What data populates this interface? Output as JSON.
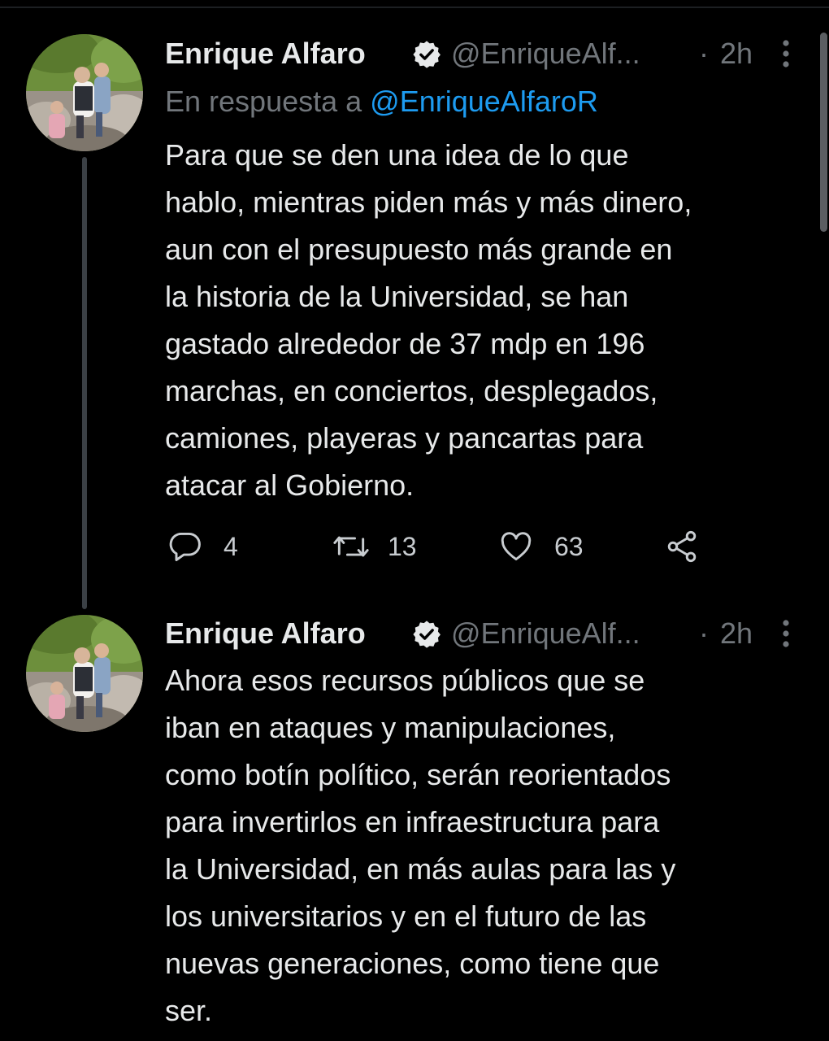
{
  "tweets": [
    {
      "author_name": "Enrique Alfaro",
      "verified": true,
      "handle": "@EnriqueAlf...",
      "separator": "·",
      "time": "2h",
      "reply_prefix": "En respuesta a",
      "reply_to": "@EnriqueAlfaroR",
      "text_lines": [
        "Para que se den una idea de lo que",
        "hablo, mientras piden más y más dinero,",
        "aun con el presupuesto más grande en",
        "la historia de la Universidad, se han",
        "gastado alrededor de 37 mdp en 196",
        "marchas, en conciertos, desplegados,",
        "camiones, playeras y pancartas para",
        "atacar al Gobierno."
      ],
      "actions": {
        "replies": "4",
        "retweets": "13",
        "likes": "63"
      }
    },
    {
      "author_name": "Enrique Alfaro",
      "verified": true,
      "handle": "@EnriqueAlf...",
      "separator": "·",
      "time": "2h",
      "text_lines": [
        "Ahora esos recursos públicos que se",
        "iban en ataques y manipulaciones,",
        "como botín político, serán reorientados",
        "para invertirlos en infraestructura para",
        "la Universidad, en más aulas para las y",
        "los universitarios y en el futuro de las",
        "nuevas generaciones, como tiene que",
        "ser."
      ]
    }
  ],
  "icons": {
    "verified": "verified-badge-icon",
    "more": "more-vertical-icon",
    "reply": "reply-bubble-icon",
    "retweet": "retweet-icon",
    "like": "heart-icon",
    "share": "share-icon"
  },
  "colors": {
    "background": "#000000",
    "text": "#e7e9ea",
    "secondary": "#71767b",
    "link": "#1d9bf0",
    "thread_line": "#3b4045"
  }
}
